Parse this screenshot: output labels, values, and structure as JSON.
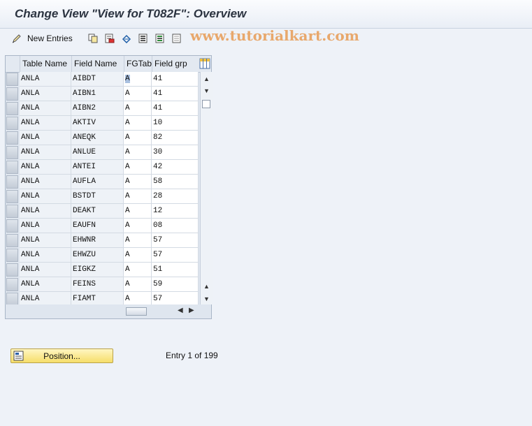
{
  "title": "Change View \"View for T082F\": Overview",
  "watermark": "www.tutorialkart.com",
  "toolbar": {
    "new_entries_label": "New Entries",
    "icons": [
      "edit-pen-icon",
      "copy-icon",
      "delete-icon",
      "undo-icon",
      "select-all-icon",
      "select-block-icon",
      "deselect-all-icon"
    ]
  },
  "table": {
    "headers": [
      "Table Name",
      "Field Name",
      "FGTab",
      "Field grp"
    ],
    "rows": [
      [
        "ANLA",
        "AIBDT",
        "A",
        "41"
      ],
      [
        "ANLA",
        "AIBN1",
        "A",
        "41"
      ],
      [
        "ANLA",
        "AIBN2",
        "A",
        "41"
      ],
      [
        "ANLA",
        "AKTIV",
        "A",
        "10"
      ],
      [
        "ANLA",
        "ANEQK",
        "A",
        "82"
      ],
      [
        "ANLA",
        "ANLUE",
        "A",
        "30"
      ],
      [
        "ANLA",
        "ANTEI",
        "A",
        "42"
      ],
      [
        "ANLA",
        "AUFLA",
        "A",
        "58"
      ],
      [
        "ANLA",
        "BSTDT",
        "A",
        "28"
      ],
      [
        "ANLA",
        "DEAKT",
        "A",
        "12"
      ],
      [
        "ANLA",
        "EAUFN",
        "A",
        "08"
      ],
      [
        "ANLA",
        "EHWNR",
        "A",
        "57"
      ],
      [
        "ANLA",
        "EHWZU",
        "A",
        "57"
      ],
      [
        "ANLA",
        "EIGKZ",
        "A",
        "51"
      ],
      [
        "ANLA",
        "FEINS",
        "A",
        "59"
      ],
      [
        "ANLA",
        "FIAMT",
        "A",
        "57"
      ]
    ]
  },
  "position_button_label": "Position...",
  "entry_info": "Entry 1 of 199"
}
